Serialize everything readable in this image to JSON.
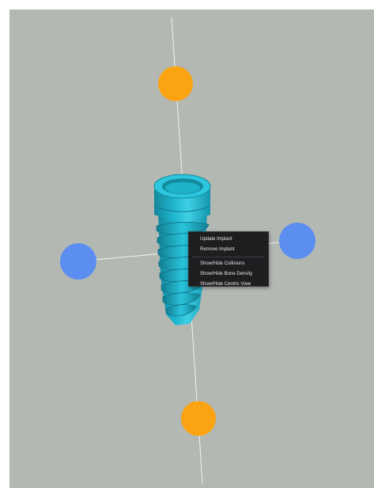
{
  "viewport": {
    "background": "#b3b8b3",
    "axis_color": "#f2f2f2",
    "handle_vertical_color": "#fca311",
    "handle_horizontal_color": "#5b8ef0",
    "implant_color": "#1fb5cf",
    "implant_shadow_color": "#14889c"
  },
  "context_menu": {
    "items": [
      {
        "label": "Update Implant"
      },
      {
        "label": "Remove Implant"
      },
      {
        "label": "Show/Hide Collisions"
      },
      {
        "label": "Show/Hide Bone Density"
      },
      {
        "label": "Show/Hide Centric View"
      }
    ]
  }
}
